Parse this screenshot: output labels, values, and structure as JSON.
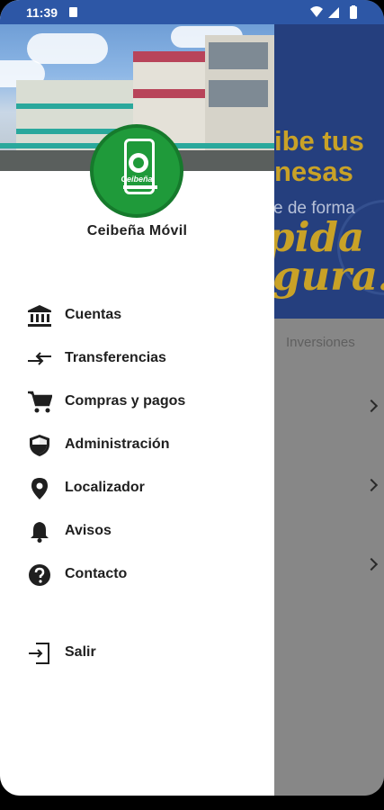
{
  "status_bar": {
    "time": "11:39"
  },
  "drawer": {
    "app_name": "Ceibeña Móvil",
    "logo_text": "Ceibeña",
    "items": [
      {
        "label": "Cuentas",
        "icon": "bank-icon"
      },
      {
        "label": "Transferencias",
        "icon": "transfer-arrows-icon"
      },
      {
        "label": "Compras y pagos",
        "icon": "cart-icon"
      },
      {
        "label": "Administración",
        "icon": "shield-icon"
      },
      {
        "label": "Localizador",
        "icon": "location-pin-icon"
      },
      {
        "label": "Avisos",
        "icon": "bell-icon"
      },
      {
        "label": "Contacto",
        "icon": "help-circle-icon"
      },
      {
        "label": "Salir",
        "icon": "logout-icon"
      }
    ]
  },
  "background": {
    "banner_line1": "ibe tus",
    "banner_line2": "nesas",
    "banner_line3": "e de forma",
    "banner_line4": "pida",
    "banner_line5": "gura!",
    "tab_label": "Inversiones"
  },
  "colors": {
    "status_bar": "#2d57a6",
    "banner_bg": "#253f7e",
    "banner_accent": "#c9a227",
    "logo_green": "#1f9a3a",
    "menu_text": "#1f1f1f"
  }
}
